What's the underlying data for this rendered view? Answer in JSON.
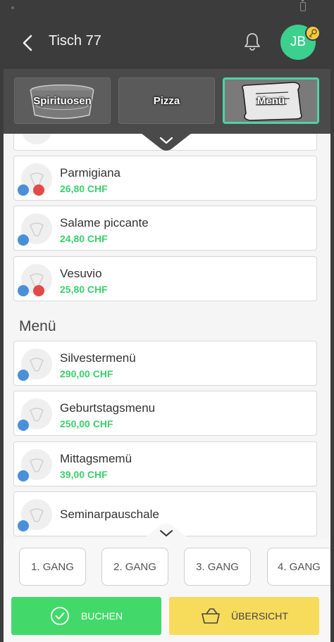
{
  "header": {
    "title": "Tisch 77",
    "avatar_initials": "JB"
  },
  "categories": [
    {
      "label": "Spirituosen"
    },
    {
      "label": "Pizza"
    },
    {
      "label": "Menü",
      "active": true
    }
  ],
  "pizza_items": [
    {
      "name": "Parmigiana",
      "price": "26,80 CHF",
      "badges": [
        "grid-icon",
        "drop-icon"
      ]
    },
    {
      "name": "Salame piccante",
      "price": "24,80 CHF",
      "badges": [
        "grid-icon"
      ]
    },
    {
      "name": "Vesuvio",
      "price": "25,80 CHF",
      "badges": [
        "grid-icon",
        "drop-icon"
      ]
    }
  ],
  "menu_section": {
    "title": "Menü",
    "items": [
      {
        "name": "Silvestermenü",
        "price": "290,00 CHF"
      },
      {
        "name": "Geburtstagsmenu",
        "price": "250,00 CHF"
      },
      {
        "name": "Mittagsmemü",
        "price": "39,00 CHF"
      },
      {
        "name": "Seminarpauschale",
        "price": ""
      }
    ]
  },
  "courses": [
    "1. GANG",
    "2. GANG",
    "3. GANG",
    "4. GANG"
  ],
  "actions": {
    "book_label": "BUCHEN",
    "overview_label": "ÜBERSICHT"
  },
  "colors": {
    "accent_green": "#43d96a",
    "price_green": "#3ccf6e",
    "avatar_green": "#3ccf8e",
    "overview_yellow": "#f7db5b",
    "active_border": "#4fd2a6"
  }
}
